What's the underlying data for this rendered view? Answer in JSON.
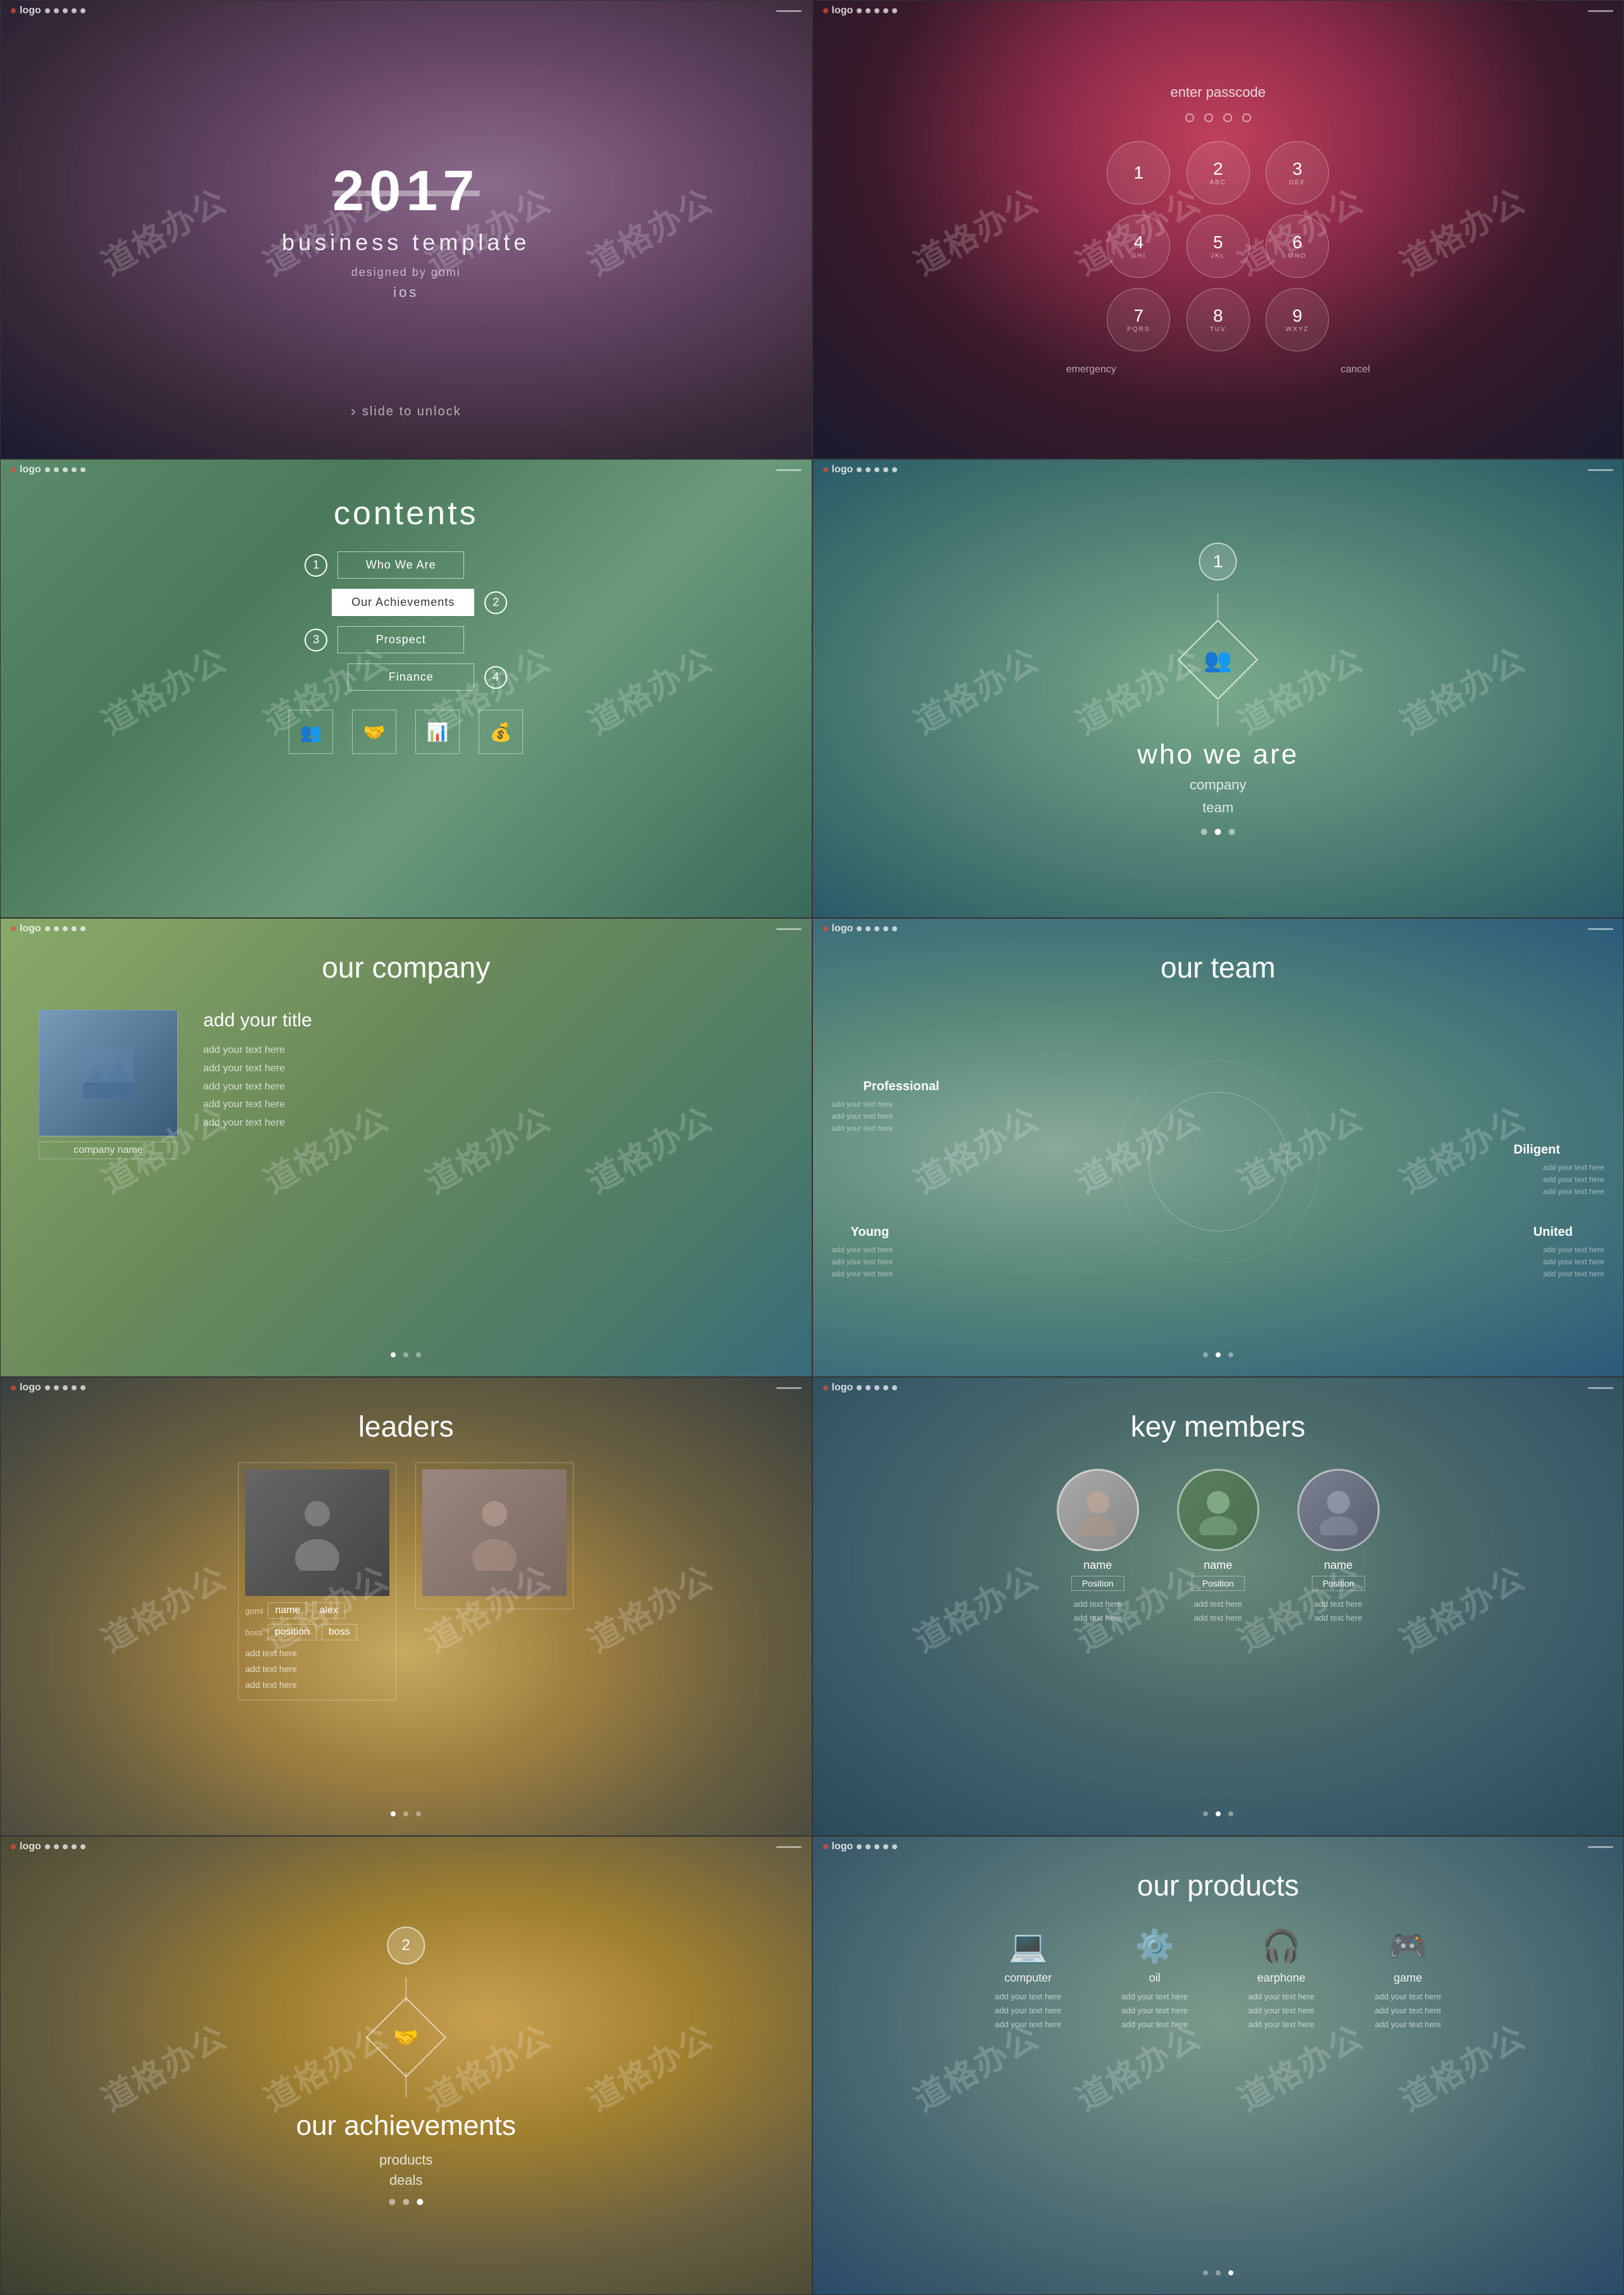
{
  "watermark": "道格办公",
  "slides": [
    {
      "id": 1,
      "type": "title",
      "number": "1",
      "logo": "logo",
      "year": "2017",
      "subtitle": "business template",
      "designed": "designed by gomi",
      "platform": "ios",
      "slide_to_unlock": "slide to unlock"
    },
    {
      "id": 2,
      "type": "passcode",
      "number": "2",
      "logo": "logo",
      "title": "enter passcode",
      "dots": 4,
      "numpad": [
        {
          "main": "1",
          "sub": ""
        },
        {
          "main": "2",
          "sub": "ABC"
        },
        {
          "main": "3",
          "sub": "DEF"
        },
        {
          "main": "4",
          "sub": "GHI"
        },
        {
          "main": "5",
          "sub": "JKL"
        },
        {
          "main": "6",
          "sub": "MNO"
        },
        {
          "main": "7",
          "sub": "PQRS"
        },
        {
          "main": "8",
          "sub": "TUV"
        },
        {
          "main": "9",
          "sub": "WXYZ"
        }
      ],
      "emergency": "emergency",
      "cancel": "cancel"
    },
    {
      "id": 3,
      "type": "contents",
      "number": "3",
      "logo": "logo",
      "title": "contents",
      "items": [
        {
          "num": "1",
          "label": "Who We Are",
          "active": false
        },
        {
          "num": "2",
          "label": "Our Achievements",
          "active": true
        },
        {
          "num": "3",
          "label": "Prospect",
          "active": false
        },
        {
          "num": "4",
          "label": "Finance",
          "active": false
        }
      ],
      "icons": [
        "👥",
        "🤝",
        "📊",
        "💰"
      ]
    },
    {
      "id": 4,
      "type": "who_we_are",
      "number": "4",
      "logo": "logo",
      "badge_num": "1",
      "title": "who we are",
      "sub1": "company",
      "sub2": "team",
      "dots": 3
    },
    {
      "id": 5,
      "type": "our_company",
      "number": "5",
      "logo": "logo",
      "title": "our company",
      "add_title": "add your title",
      "texts": [
        "add your text here",
        "add your text here",
        "add your text here",
        "add your text here",
        "add your text here"
      ],
      "company_name": "company name",
      "dots": 3
    },
    {
      "id": 6,
      "type": "our_team",
      "number": "6",
      "logo": "logo",
      "title": "our team",
      "labels": [
        "Professional",
        "Diligent",
        "United",
        "Young"
      ],
      "sub_texts": [
        "add your text here\nadd your text here\nadd your text here",
        "add your text here\nadd your text here\nadd your text here",
        "add your text here\nadd your text here\nadd your text here",
        "add your text here\nadd your text here\nadd your text here"
      ],
      "dots": 3
    },
    {
      "id": 7,
      "type": "leaders",
      "number": "7",
      "logo": "logo",
      "title": "leaders",
      "leaders": [
        {
          "name_tag": "gomi",
          "name": "name",
          "name2": "alex",
          "pos_tag": "boss",
          "pos": "position",
          "pos2": "boss",
          "texts": [
            "add text here",
            "add text here",
            "add text here"
          ]
        },
        {
          "name_tag": "",
          "name": "",
          "name2": "",
          "pos_tag": "",
          "pos": "",
          "pos2": "",
          "texts": []
        }
      ],
      "dots": 3
    },
    {
      "id": 8,
      "type": "key_members",
      "number": "8",
      "logo": "logo",
      "title": "key members",
      "members": [
        {
          "name": "name",
          "position": "Position",
          "texts": [
            "add text here",
            "add text here"
          ]
        },
        {
          "name": "name",
          "position": "Position",
          "texts": [
            "add text here",
            "add text here"
          ]
        },
        {
          "name": "name",
          "position": "Position",
          "texts": [
            "add text here",
            "add text here"
          ]
        }
      ],
      "dots": 3
    },
    {
      "id": 9,
      "type": "our_achievements",
      "number": "9",
      "logo": "logo",
      "badge_num": "2",
      "title": "our achievements",
      "items": [
        "products",
        "deals"
      ],
      "dots": 3
    },
    {
      "id": 10,
      "type": "our_products",
      "number": "10",
      "logo": "logo",
      "title": "our products",
      "products": [
        {
          "icon": "💻",
          "name": "computer",
          "texts": [
            "add your text here",
            "add your text here",
            "add your text here"
          ]
        },
        {
          "icon": "⚙️",
          "name": "oil",
          "texts": [
            "add your text here",
            "add your text here",
            "add your text here"
          ]
        },
        {
          "icon": "🎧",
          "name": "earphone",
          "texts": [
            "add your text here",
            "add your text here",
            "add your text here"
          ]
        },
        {
          "icon": "🎮",
          "name": "game",
          "texts": [
            "add your text here",
            "add your text here",
            "add your text here"
          ]
        }
      ],
      "dots": 3
    }
  ]
}
